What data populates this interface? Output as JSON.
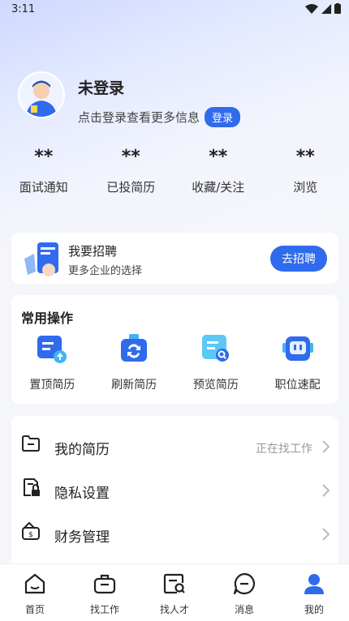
{
  "status_bar": {
    "time": "3:11"
  },
  "profile": {
    "name": "未登录",
    "subtitle": "点击登录查看更多信息",
    "login_label": "登录"
  },
  "stats": [
    {
      "value": "**",
      "label": "面试通知"
    },
    {
      "value": "**",
      "label": "已投简历"
    },
    {
      "value": "**",
      "label": "收藏/关注"
    },
    {
      "value": "**",
      "label": "浏览"
    }
  ],
  "recruit": {
    "title": "我要招聘",
    "subtitle": "更多企业的选择",
    "button": "去招聘"
  },
  "common_ops": {
    "title": "常用操作",
    "items": [
      {
        "label": "置顶简历",
        "icon": "pin-resume-icon"
      },
      {
        "label": "刷新简历",
        "icon": "refresh-resume-icon"
      },
      {
        "label": "预览简历",
        "icon": "preview-resume-icon"
      },
      {
        "label": "职位速配",
        "icon": "job-match-icon"
      }
    ]
  },
  "menu": [
    {
      "label": "我的简历",
      "value": "正在找工作",
      "icon": "folder-icon"
    },
    {
      "label": "隐私设置",
      "value": "",
      "icon": "privacy-lock-icon"
    },
    {
      "label": "财务管理",
      "value": "",
      "icon": "wallet-icon"
    }
  ],
  "tabbar": [
    {
      "label": "首页",
      "icon": "home-icon",
      "active": false
    },
    {
      "label": "找工作",
      "icon": "briefcase-icon",
      "active": false
    },
    {
      "label": "找人才",
      "icon": "talent-search-icon",
      "active": false
    },
    {
      "label": "消息",
      "icon": "message-icon",
      "active": false
    },
    {
      "label": "我的",
      "icon": "profile-icon",
      "active": true
    }
  ],
  "colors": {
    "accent": "#2f6bec",
    "text": "#222222",
    "muted": "#999999"
  }
}
